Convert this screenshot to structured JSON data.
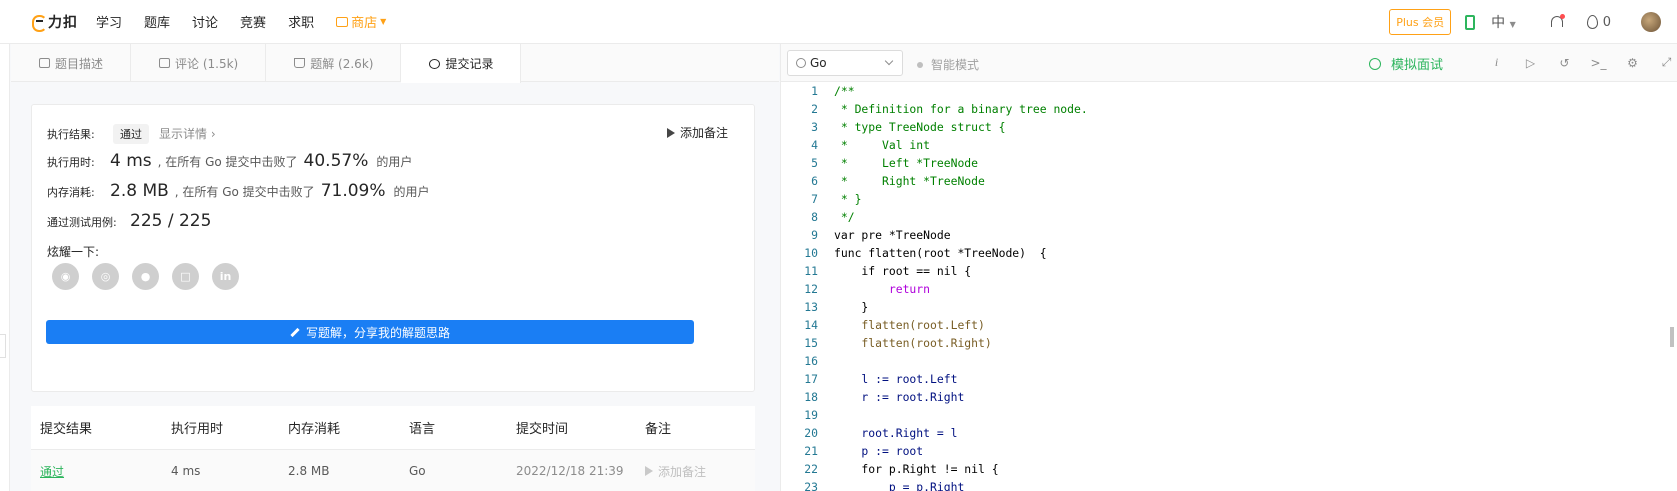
{
  "nav": {
    "logo_text": "力扣",
    "links": [
      "学习",
      "题库",
      "讨论",
      "竞赛",
      "求职"
    ],
    "store": "商店",
    "plus": "Plus 会员",
    "lang": "中",
    "fire_count": "0"
  },
  "tabs": [
    {
      "label": "题目描述"
    },
    {
      "label": "评论 (1.5k)"
    },
    {
      "label": "题解 (2.6k)"
    },
    {
      "label": "提交记录"
    }
  ],
  "result": {
    "exec_label": "执行结果:",
    "status": "通过",
    "detail": "显示详情 ›",
    "add_note": "添加备注",
    "time_label": "执行用时:",
    "time_value": "4 ms",
    "time_mid": ", 在所有 Go 提交中击败了",
    "time_pct": "40.57%",
    "time_tail": "的用户",
    "mem_label": "内存消耗:",
    "mem_value": "2.8 MB",
    "mem_mid": ", 在所有 Go 提交中击败了",
    "mem_pct": "71.09%",
    "mem_tail": "的用户",
    "cases_label": "通过测试用例:",
    "cases_value": "225 / 225",
    "share_label": "炫耀一下:",
    "write_btn": "写题解，分享我的解题思路"
  },
  "table": {
    "headers": [
      "提交结果",
      "执行用时",
      "内存消耗",
      "语言",
      "提交时间",
      "备注"
    ],
    "rows": [
      {
        "result": "通过",
        "time": "4 ms",
        "mem": "2.8 MB",
        "lang": "Go",
        "date": "2022/12/18 21:39",
        "note": "添加备注"
      }
    ]
  },
  "editor": {
    "lang": "Go",
    "smart": "智能模式",
    "mock": "模拟面试",
    "lines": [
      {
        "n": "1",
        "t": "/**"
      },
      {
        "n": "2",
        "t": " * Definition for a binary tree node."
      },
      {
        "n": "3",
        "t": " * type TreeNode struct {"
      },
      {
        "n": "4",
        "t": " *     Val int"
      },
      {
        "n": "5",
        "t": " *     Left *TreeNode"
      },
      {
        "n": "6",
        "t": " *     Right *TreeNode"
      },
      {
        "n": "7",
        "t": " * }"
      },
      {
        "n": "8",
        "t": " */"
      },
      {
        "n": "9",
        "t": "var pre *TreeNode"
      },
      {
        "n": "10",
        "t": "func flatten(root *TreeNode)  {"
      },
      {
        "n": "11",
        "t": "    if root == nil {"
      },
      {
        "n": "12",
        "t": "        return"
      },
      {
        "n": "13",
        "t": "    }"
      },
      {
        "n": "14",
        "t": "    flatten(root.Left)"
      },
      {
        "n": "15",
        "t": "    flatten(root.Right)"
      },
      {
        "n": "16",
        "t": ""
      },
      {
        "n": "17",
        "t": "    l := root.Left"
      },
      {
        "n": "18",
        "t": "    r := root.Right"
      },
      {
        "n": "19",
        "t": ""
      },
      {
        "n": "20",
        "t": "    root.Right = l"
      },
      {
        "n": "21",
        "t": "    p := root"
      },
      {
        "n": "22",
        "t": "    for p.Right != nil {"
      },
      {
        "n": "23",
        "t": "        p = p.Right"
      }
    ]
  }
}
